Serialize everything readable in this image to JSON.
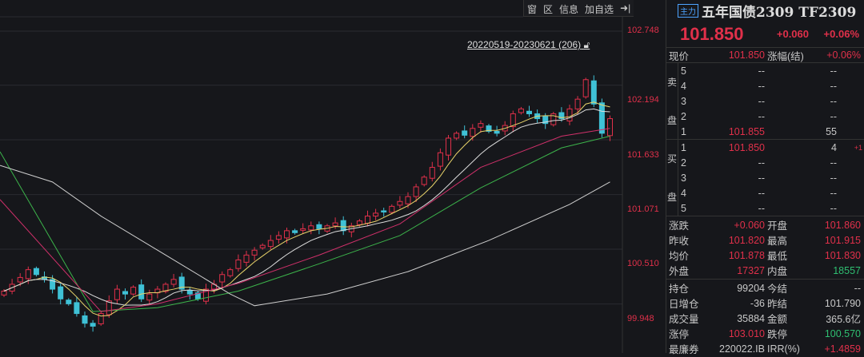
{
  "toolbar": {
    "items": [
      "窗",
      "区",
      "信息",
      "加自选",
      "➜|"
    ]
  },
  "range_label": "20220519-20230621 (206)",
  "axis": {
    "ticks": [
      "102.748",
      "102.194",
      "101.633",
      "101.071",
      "100.510",
      "99.948"
    ]
  },
  "header": {
    "badge": "主力",
    "title": "五年国债2309 TF2309",
    "price": "101.850",
    "change": "+0.060",
    "change_pct": "+0.06%"
  },
  "quote": {
    "label1": "现价",
    "value1": "101.850",
    "label2": "涨幅(结)",
    "value2": "+0.06%"
  },
  "sell": {
    "label": [
      "卖",
      "盘"
    ],
    "levels": [
      {
        "lv": "5",
        "price": "--",
        "vol": "--"
      },
      {
        "lv": "4",
        "price": "--",
        "vol": "--"
      },
      {
        "lv": "3",
        "price": "--",
        "vol": "--"
      },
      {
        "lv": "2",
        "price": "--",
        "vol": "--"
      },
      {
        "lv": "1",
        "price": "101.855",
        "vol": "55"
      }
    ]
  },
  "buy": {
    "label": [
      "买",
      "盘"
    ],
    "levels": [
      {
        "lv": "1",
        "price": "101.850",
        "vol": "4",
        "delta": "+1"
      },
      {
        "lv": "2",
        "price": "--",
        "vol": "--",
        "delta": ""
      },
      {
        "lv": "3",
        "price": "--",
        "vol": "--",
        "delta": ""
      },
      {
        "lv": "4",
        "price": "--",
        "vol": "--",
        "delta": ""
      },
      {
        "lv": "5",
        "price": "--",
        "vol": "--",
        "delta": ""
      }
    ]
  },
  "stats1": [
    {
      "l1": "涨跌",
      "v1": "+0.060",
      "c1": "red",
      "l2": "开盘",
      "v2": "101.860",
      "c2": "red"
    },
    {
      "l1": "昨收",
      "v1": "101.820",
      "c1": "red",
      "l2": "最高",
      "v2": "101.915",
      "c2": "red"
    },
    {
      "l1": "均价",
      "v1": "101.878",
      "c1": "red",
      "l2": "最低",
      "v2": "101.830",
      "c2": "red"
    },
    {
      "l1": "外盘",
      "v1": "17327",
      "c1": "red",
      "l2": "内盘",
      "v2": "18557",
      "c2": "green"
    }
  ],
  "stats2": [
    {
      "l1": "持仓",
      "v1": "99204",
      "c1": "",
      "l2": "今结",
      "v2": "--",
      "c2": ""
    },
    {
      "l1": "日增仓",
      "v1": "-36",
      "c1": "",
      "l2": "昨结",
      "v2": "101.790",
      "c2": ""
    },
    {
      "l1": "成交量",
      "v1": "35884",
      "c1": "",
      "l2": "金额",
      "v2": "365.6亿",
      "c2": ""
    },
    {
      "l1": "涨停",
      "v1": "103.010",
      "c1": "red",
      "l2": "跌停",
      "v2": "100.570",
      "c2": "green"
    },
    {
      "l1": "最廉券",
      "v1": "220022.IB",
      "c1": "",
      "l2": "IRR(%)",
      "v2": "+1.4859",
      "c2": "red"
    }
  ],
  "chart_data": {
    "type": "candlestick",
    "ylim": [
      99.75,
      102.95
    ],
    "yticks": [
      102.748,
      102.194,
      101.633,
      101.071,
      100.51,
      99.948
    ],
    "closes": [
      100.08,
      100.15,
      100.22,
      100.3,
      100.25,
      100.2,
      100.1,
      100.0,
      99.95,
      99.85,
      99.75,
      99.72,
      99.85,
      99.98,
      100.1,
      100.05,
      100.12,
      100.0,
      100.05,
      100.1,
      100.15,
      100.2,
      100.1,
      100.05,
      100.0,
      100.1,
      100.15,
      100.25,
      100.3,
      100.4,
      100.45,
      100.5,
      100.55,
      100.6,
      100.65,
      100.7,
      100.68,
      100.72,
      100.75,
      100.72,
      100.75,
      100.78,
      100.7,
      100.75,
      100.8,
      100.85,
      100.88,
      100.9,
      100.95,
      101.0,
      101.05,
      101.15,
      101.25,
      101.35,
      101.5,
      101.65,
      101.7,
      101.68,
      101.75,
      101.8,
      101.72,
      101.7,
      101.78,
      101.9,
      101.95,
      101.9,
      101.85,
      101.8,
      101.9,
      101.85,
      101.95,
      102.05,
      102.25,
      102.0,
      101.7,
      101.85
    ],
    "series": [
      {
        "name": "MA5",
        "color": "#e8d36a",
        "period": 5
      },
      {
        "name": "MA10",
        "color": "#dddddd",
        "period": 10
      },
      {
        "name": "MA-long-green",
        "color": "#3cb44b",
        "points": [
          [
            0,
            101.51
          ],
          [
            11,
            99.87
          ],
          [
            19,
            99.91
          ],
          [
            29,
            100.08
          ],
          [
            39,
            100.36
          ],
          [
            49,
            100.65
          ],
          [
            59,
            101.14
          ],
          [
            69,
            101.55
          ],
          [
            75,
            101.67
          ]
        ]
      },
      {
        "name": "MA-long-magenta",
        "color": "#d0306a",
        "points": [
          [
            0,
            101.02
          ],
          [
            12,
            99.87
          ],
          [
            19,
            99.95
          ],
          [
            29,
            100.16
          ],
          [
            39,
            100.45
          ],
          [
            49,
            100.77
          ],
          [
            59,
            101.35
          ],
          [
            69,
            101.67
          ],
          [
            75,
            101.75
          ]
        ]
      },
      {
        "name": "MA-long-white",
        "color": "#cfcfcf",
        "points": [
          [
            0,
            101.37
          ],
          [
            6,
            101.2
          ],
          [
            12,
            100.85
          ],
          [
            20,
            100.45
          ],
          [
            28,
            100.05
          ],
          [
            31,
            99.93
          ],
          [
            40,
            100.05
          ],
          [
            50,
            100.28
          ],
          [
            60,
            100.6
          ],
          [
            70,
            100.97
          ],
          [
            75,
            101.2
          ]
        ]
      }
    ],
    "up_color": "#e0304a",
    "down_color": "#3fc1d6"
  }
}
